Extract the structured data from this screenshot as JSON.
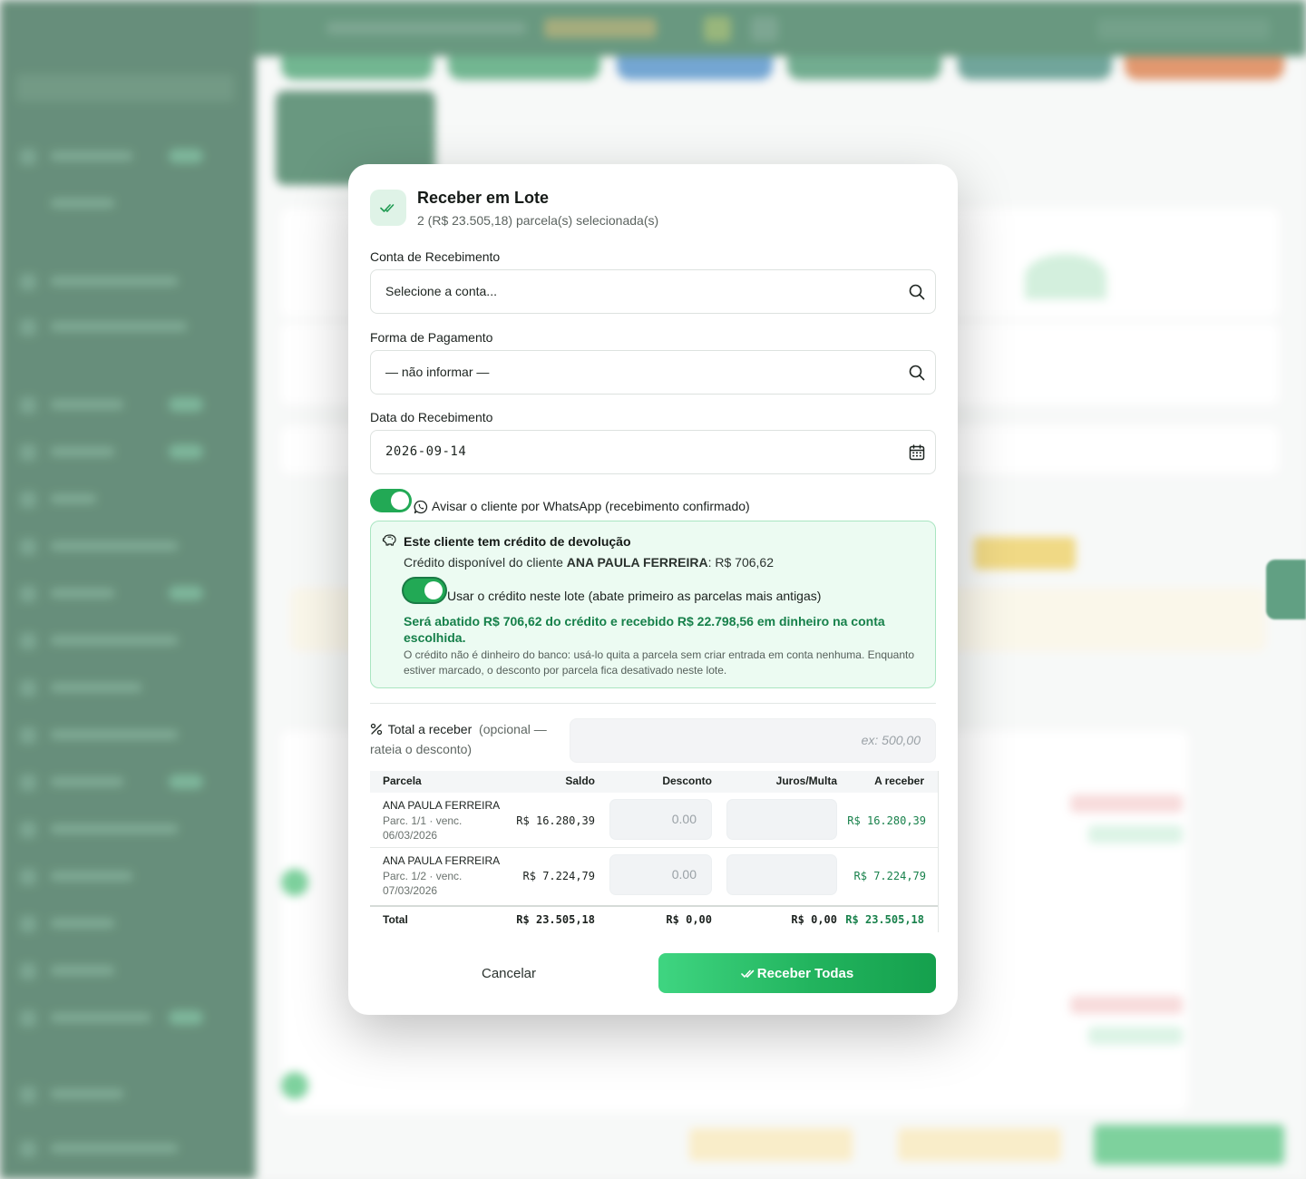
{
  "modal": {
    "title": "Receber em Lote",
    "subtitle": "2 (R$ 23.505,18) parcela(s) selecionada(s)",
    "conta": {
      "label": "Conta de Recebimento",
      "value": "Selecione a conta..."
    },
    "forma": {
      "label": "Forma de Pagamento",
      "value": "— não informar —"
    },
    "data": {
      "label": "Data do Recebimento",
      "value": "2026-09-14"
    },
    "whatsapp": {
      "label": "Avisar o cliente por WhatsApp (recebimento confirmado)",
      "enabled": true
    },
    "credit": {
      "title": "Este cliente tem crédito de devolução",
      "available_prefix": "Crédito disponível do cliente",
      "client": "ANA PAULA FERREIRA",
      "available_value": ": R$ 706,62",
      "use_label": "Usar o crédito neste lote (abate primeiro as parcelas mais antigas)",
      "use_enabled": true,
      "summary": "Será abatido R$ 706,62 do crédito e recebido R$ 22.798,56 em dinheiro na conta escolhida.",
      "note": "O crédito não é dinheiro do banco: usá-lo quita a parcela sem criar entrada em conta nenhuma. Enquanto estiver marcado, o desconto por parcela fica desativado neste lote."
    },
    "total": {
      "label": "Total a receber",
      "optional": "(opcional — rateia o desconto)",
      "placeholder": "ex: 500,00"
    },
    "table": {
      "headers": {
        "parcela": "Parcela",
        "saldo": "Saldo",
        "desconto": "Desconto",
        "juros": "Juros/Multa",
        "receber": "A receber"
      },
      "rows": [
        {
          "name": "ANA PAULA FERREIRA",
          "meta": "Parc. 1/1 · venc. 06/03/2026",
          "saldo": "R$ 16.280,39",
          "desconto": "0.00",
          "juros": "",
          "receber": "R$ 16.280,39"
        },
        {
          "name": "ANA PAULA FERREIRA",
          "meta": "Parc. 1/2 · venc. 07/03/2026",
          "saldo": "R$ 7.224,79",
          "desconto": "0.00",
          "juros": "",
          "receber": "R$ 7.224,79"
        }
      ],
      "footer": {
        "label": "Total",
        "saldo": "R$ 23.505,18",
        "desconto": "R$ 0,00",
        "juros": "R$ 0,00",
        "receber": "R$ 23.505,18"
      }
    },
    "buttons": {
      "cancel": "Cancelar",
      "confirm": "Receber Todas"
    }
  },
  "colors": {
    "primary_green": "#22a955",
    "dark_sidebar": "#0b4a2a",
    "credit_bg": "#ecfbf2",
    "money_green": "#18814b"
  },
  "icons": {
    "header": "double-check-icon",
    "conta": "search-icon",
    "forma": "search-icon",
    "data": "calendar-icon",
    "whatsapp": "whatsapp-icon",
    "credit": "piggy-bank-icon",
    "total": "percent-icon",
    "confirm": "double-check-icon"
  }
}
